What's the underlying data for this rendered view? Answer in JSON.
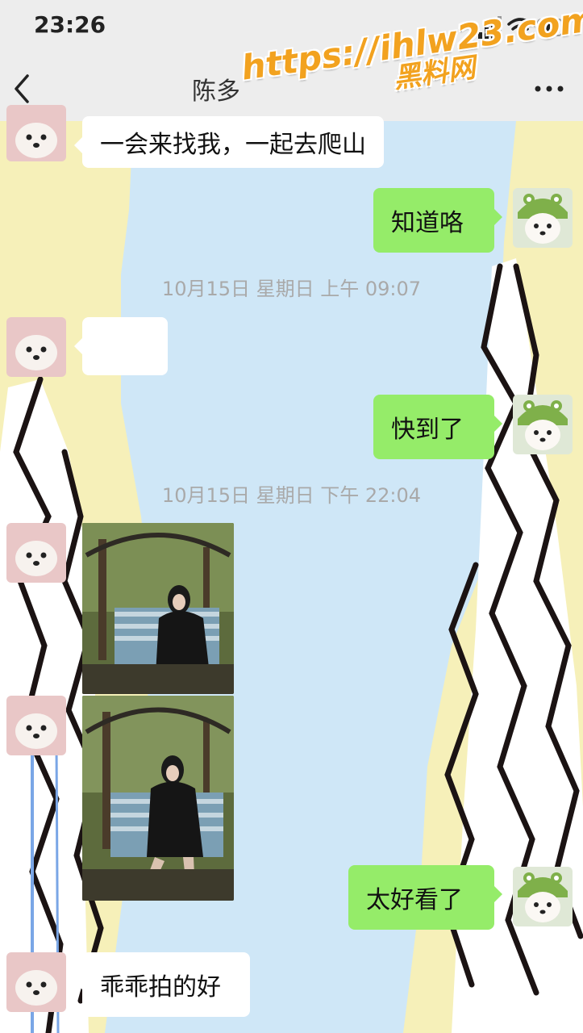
{
  "status_bar": {
    "time": "23:26"
  },
  "nav": {
    "title": "陈多",
    "back_icon": "back-arrow-icon",
    "more_icon": "more-dots-icon"
  },
  "watermark": {
    "line1": "https://ihlw23.com",
    "line2": "黑料网"
  },
  "messages": [
    {
      "side": "left",
      "type": "text",
      "text": "一会来找我，一起去爬山"
    },
    {
      "side": "right",
      "type": "text",
      "text": "知道咯"
    },
    {
      "type": "timestamp",
      "text": "10月15日 星期日 上午 09:07"
    },
    {
      "side": "left",
      "type": "text",
      "text": ""
    },
    {
      "side": "right",
      "type": "text",
      "text": "快到了"
    },
    {
      "type": "timestamp",
      "text": "10月15日 星期日 下午 22:04"
    },
    {
      "side": "left",
      "type": "image",
      "description": "photo"
    },
    {
      "side": "left",
      "type": "image",
      "description": "photo"
    },
    {
      "side": "right",
      "type": "text",
      "text": "太好看了"
    },
    {
      "side": "left",
      "type": "text",
      "text": "乖乖拍的好"
    }
  ],
  "colors": {
    "green_bubble": "#95ec69",
    "white_bubble": "#ffffff",
    "header_bg": "#ededed",
    "timestamp_text": "#a9a9a9",
    "watermark": "#f2a21f"
  }
}
